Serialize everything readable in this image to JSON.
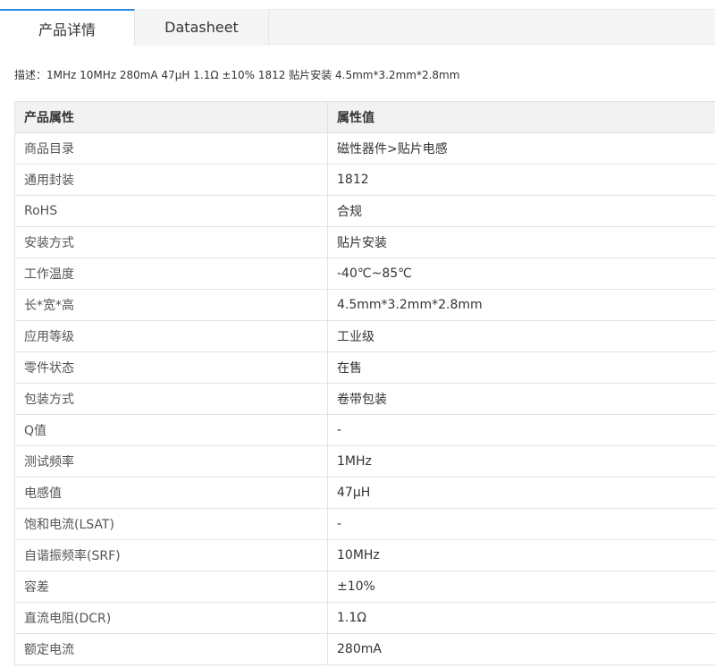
{
  "tabs": [
    {
      "label": "产品详情",
      "active": true
    },
    {
      "label": "Datasheet",
      "active": false
    }
  ],
  "description": "描述：1MHz 10MHz 280mA 47μH 1.1Ω ±10% 1812 贴片安装 4.5mm*3.2mm*2.8mm",
  "table": {
    "headers": [
      "产品属性",
      "属性值"
    ],
    "rows": [
      [
        "商品目录",
        "磁性器件>贴片电感"
      ],
      [
        "通用封装",
        "1812"
      ],
      [
        "RoHS",
        "合规"
      ],
      [
        "安装方式",
        "贴片安装"
      ],
      [
        "工作温度",
        "-40℃~85℃"
      ],
      [
        "长*宽*高",
        "4.5mm*3.2mm*2.8mm"
      ],
      [
        "应用等级",
        "工业级"
      ],
      [
        "零件状态",
        "在售"
      ],
      [
        "包装方式",
        "卷带包装"
      ],
      [
        "Q值",
        "-"
      ],
      [
        "测试频率",
        "1MHz"
      ],
      [
        "电感值",
        "47μH"
      ],
      [
        "饱和电流(LSAT)",
        "-"
      ],
      [
        "自谐振频率(SRF)",
        "10MHz"
      ],
      [
        "容差",
        "±10%"
      ],
      [
        "直流电阻(DCR)",
        "1.1Ω"
      ],
      [
        "额定电流",
        "280mA"
      ]
    ]
  },
  "colors": {
    "active_tab_accent": "#2a8be5",
    "header_bg": "#f2f2f2",
    "tabbar_bg": "#f5f5f5",
    "border": "#e3e3e3"
  }
}
